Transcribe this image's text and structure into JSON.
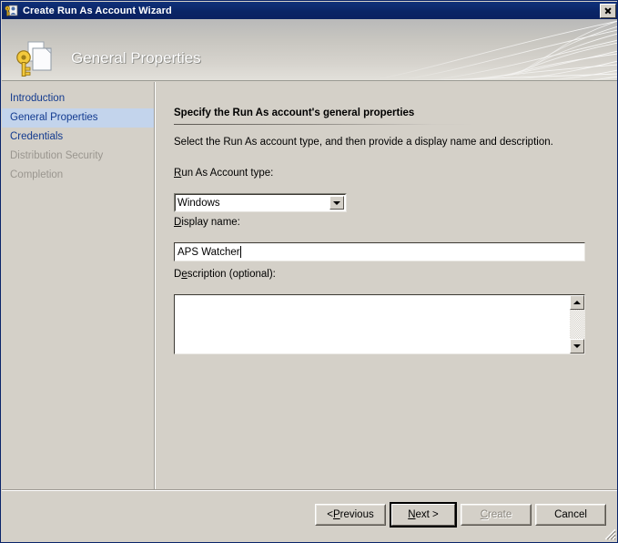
{
  "window": {
    "title": "Create Run As Account Wizard",
    "title_icon": "run-as-account-icon",
    "close_label": "Close"
  },
  "banner": {
    "heading": "General Properties",
    "icon": "key-document-icon"
  },
  "sidebar": {
    "items": [
      {
        "label": "Introduction",
        "state": "enabled"
      },
      {
        "label": "General Properties",
        "state": "selected"
      },
      {
        "label": "Credentials",
        "state": "enabled"
      },
      {
        "label": "Distribution Security",
        "state": "disabled"
      },
      {
        "label": "Completion",
        "state": "disabled"
      }
    ]
  },
  "content": {
    "heading": "Specify the Run As account's general properties",
    "intro": "Select the Run As account type, and then provide a display name and description.",
    "account_type": {
      "label_pre": "R",
      "label_post": "un As Account type:",
      "value": "Windows",
      "options": [
        "Windows"
      ],
      "arrow_icon": "chevron-down-icon"
    },
    "display_name": {
      "label_pre": "D",
      "label_post": "isplay name:",
      "value": "APS Watcher",
      "placeholder": ""
    },
    "description": {
      "label_pre": "D",
      "label_mid": "e",
      "label_post": "scription (optional):",
      "value": "",
      "placeholder": "",
      "scroll_up_icon": "triangle-up-icon",
      "scroll_down_icon": "triangle-down-icon"
    }
  },
  "footer": {
    "buttons": [
      {
        "name": "previous",
        "pre": "< ",
        "key": "P",
        "post": "revious",
        "state": "enabled"
      },
      {
        "name": "next",
        "pre": "",
        "key": "N",
        "post": "ext >",
        "state": "default"
      },
      {
        "name": "create",
        "pre": "",
        "key": "C",
        "post": "reate",
        "state": "disabled"
      },
      {
        "name": "cancel",
        "pre": "",
        "key": "",
        "post": "Cancel",
        "state": "enabled"
      }
    ],
    "resize_grip": "resize-grip-icon"
  },
  "colors": {
    "titlebar": "#0a2566",
    "face": "#d4d0c8",
    "link": "#123a8f",
    "selection": "#c3d4ec",
    "disabled_text": "#9a968f"
  }
}
